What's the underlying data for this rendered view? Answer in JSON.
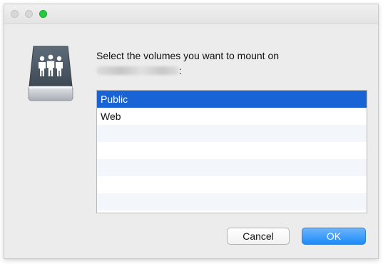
{
  "dialog": {
    "prompt_line1": "Select the volumes you want to mount on",
    "prompt_suffix": ":",
    "volumes": [
      {
        "label": "Public",
        "selected": true
      },
      {
        "label": "Web",
        "selected": false
      }
    ],
    "buttons": {
      "cancel_label": "Cancel",
      "ok_label": "OK"
    }
  },
  "colors": {
    "selection": "#1863d6",
    "ok_button": "#1c8cf8",
    "zoom_button": "#27c93f"
  },
  "icons": {
    "server": "shared-server-icon"
  }
}
